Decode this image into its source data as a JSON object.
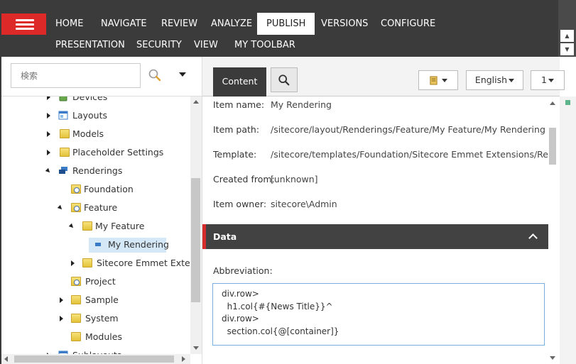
{
  "ribbon": {
    "tabs_row1": [
      "HOME",
      "NAVIGATE",
      "REVIEW",
      "ANALYZE",
      "PUBLISH",
      "VERSIONS",
      "CONFIGURE"
    ],
    "tabs_row2": [
      "PRESENTATION",
      "SECURITY",
      "VIEW",
      "MY TOOLBAR"
    ],
    "active_tab": "PUBLISH"
  },
  "search": {
    "placeholder": "検索"
  },
  "tree": {
    "items": [
      {
        "label": "Devices",
        "icon": "devices-icon",
        "state": "closed"
      },
      {
        "label": "Layouts",
        "icon": "layouts-icon",
        "state": "closed"
      },
      {
        "label": "Models",
        "icon": "folder-icon",
        "state": "closed"
      },
      {
        "label": "Placeholder Settings",
        "icon": "folder-icon",
        "state": "closed"
      },
      {
        "label": "Renderings",
        "icon": "renderings-icon",
        "state": "open"
      },
      {
        "label": "Foundation",
        "icon": "rendering-folder-icon",
        "state": "none"
      },
      {
        "label": "Feature",
        "icon": "rendering-folder-icon",
        "state": "open"
      },
      {
        "label": "My Feature",
        "icon": "folder-icon",
        "state": "open"
      },
      {
        "label": "My Rendering",
        "icon": "rendering-icon",
        "state": "none",
        "selected": true
      },
      {
        "label": "Sitecore Emmet Extensi",
        "icon": "folder-icon",
        "state": "closed"
      },
      {
        "label": "Project",
        "icon": "rendering-folder-icon",
        "state": "none"
      },
      {
        "label": "Sample",
        "icon": "folder-icon",
        "state": "closed"
      },
      {
        "label": "System",
        "icon": "folder-icon",
        "state": "closed"
      },
      {
        "label": "Modules",
        "icon": "folder-icon",
        "state": "none"
      },
      {
        "label": "Sublayouts",
        "icon": "sublayouts-icon",
        "state": "closed"
      }
    ]
  },
  "toolbar": {
    "content_tab": "Content",
    "language": "English",
    "version": "1"
  },
  "fields": {
    "item_name_label": "Item name:",
    "item_name": "My Rendering",
    "item_path_label": "Item path:",
    "item_path": "/sitecore/layout/Renderings/Feature/My Feature/My Rendering",
    "template_label": "Template:",
    "template": "/sitecore/templates/Foundation/Sitecore Emmet Extensions/Rendering",
    "created_from_label": "Created from:",
    "created_from": "[unknown]",
    "item_owner_label": "Item owner:",
    "item_owner": "sitecore\\Admin"
  },
  "section": {
    "title": "Data"
  },
  "abbreviation": {
    "label": "Abbreviation:",
    "value": "div.row>\n  h1.col{#{News Title}}^\ndiv.row>\n  section.col{@[container]}"
  },
  "colors": {
    "ribbon_bg": "#3b3b3b",
    "accent_red": "#de2929",
    "section_bg": "#424242",
    "selection": "#d5e8f7"
  }
}
